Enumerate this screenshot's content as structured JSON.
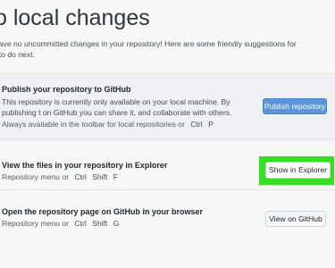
{
  "header": {
    "title": "o local changes",
    "intro": "have no uncommitted changes in your repository! Here are some friendly suggestions for t to do next."
  },
  "publish": {
    "title": "Publish your repository to GitHub",
    "description": "This repository is currently only available on your local machine. By publishing t on GitHub you can share it, and collaborate with others.",
    "hint": "Always available in the toolbar for local repositories or",
    "keys": [
      "Ctrl",
      "P"
    ],
    "button": "Publish repository"
  },
  "explorer": {
    "title": "View the files in your repository in Explorer",
    "hint": "Repository menu or",
    "keys": [
      "Ctrl",
      "Shift",
      "F"
    ],
    "button": "Show in Explorer",
    "highlight_color": "#34e01f"
  },
  "github": {
    "title": "Open the repository page on GitHub in your browser",
    "hint": "Repository menu or",
    "keys": [
      "Ctrl",
      "Shift",
      "G"
    ],
    "button": "View on GitHub"
  },
  "colors": {
    "primary_button": "#5b95d6",
    "background": "#f7f7f7"
  }
}
